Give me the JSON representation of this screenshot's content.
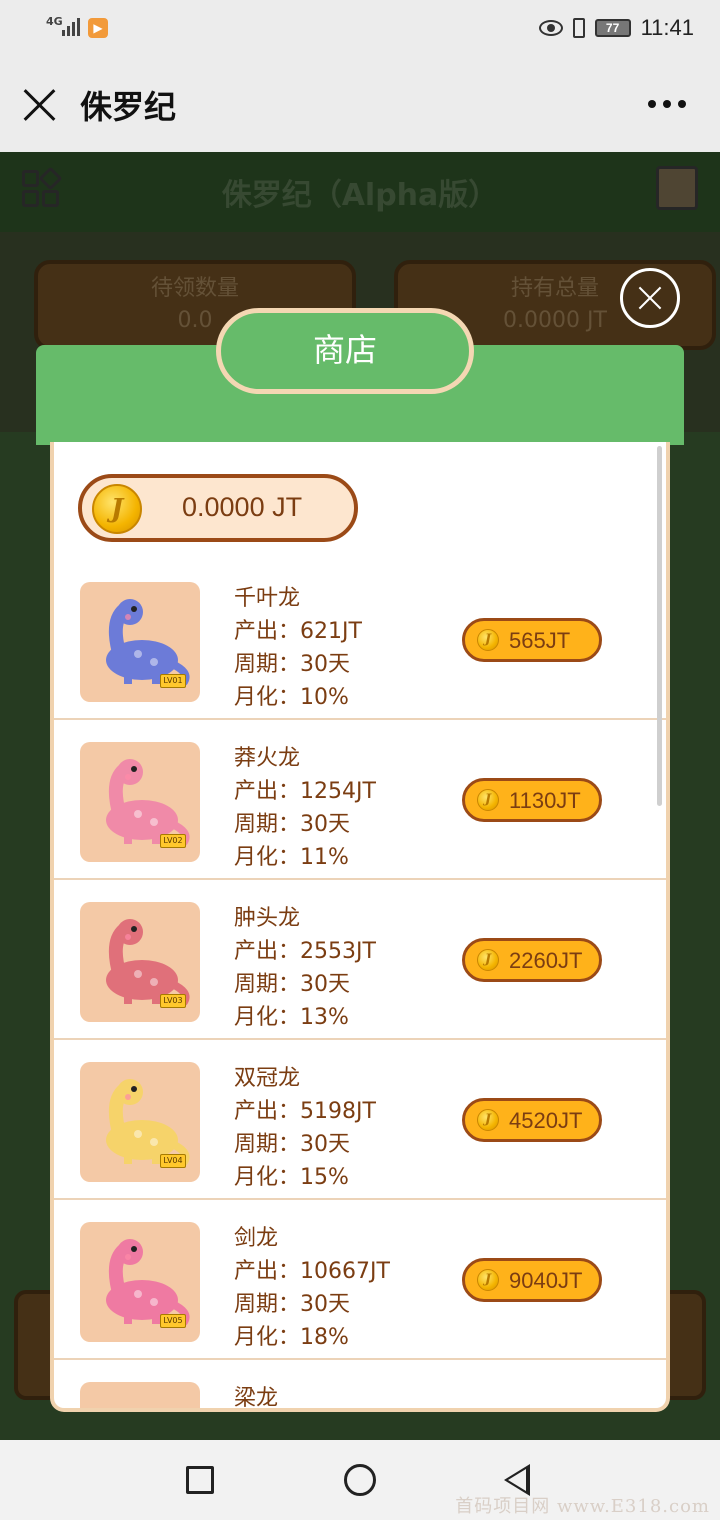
{
  "status_bar": {
    "network": "4G",
    "battery": "77",
    "time": "11:41"
  },
  "title_bar": {
    "title": "侏罗纪"
  },
  "background_app": {
    "title": "侏罗纪（Alpha版）",
    "pending_label": "待领数量",
    "pending_value": "0.0",
    "total_label": "持有总量",
    "total_value": "0.0000 JT"
  },
  "shop": {
    "title": "商店",
    "balance": "0.0000 JT",
    "items": [
      {
        "name": "千叶龙",
        "output": "产出：621JT",
        "period": "周期：30天",
        "monthly": "月化：10%",
        "price": "565JT",
        "level": "LV01",
        "color": "#6c7bd8"
      },
      {
        "name": "莽火龙",
        "output": "产出：1254JT",
        "period": "周期：30天",
        "monthly": "月化：11%",
        "price": "1130JT",
        "level": "LV02",
        "color": "#f08aa8"
      },
      {
        "name": "肿头龙",
        "output": "产出：2553JT",
        "period": "周期：30天",
        "monthly": "月化：13%",
        "price": "2260JT",
        "level": "LV03",
        "color": "#e0707a"
      },
      {
        "name": "双冠龙",
        "output": "产出：5198JT",
        "period": "周期：30天",
        "monthly": "月化：15%",
        "price": "4520JT",
        "level": "LV04",
        "color": "#f6d36a"
      },
      {
        "name": "剑龙",
        "output": "产出：10667JT",
        "period": "周期：30天",
        "monthly": "月化：18%",
        "price": "9040JT",
        "level": "LV05",
        "color": "#ef7aa2"
      },
      {
        "name": "梁龙",
        "output": "",
        "period": "",
        "monthly": "",
        "price": "",
        "level": "",
        "color": "#f4c9a6"
      }
    ]
  },
  "watermark": "首码项目网 www.E318.com"
}
